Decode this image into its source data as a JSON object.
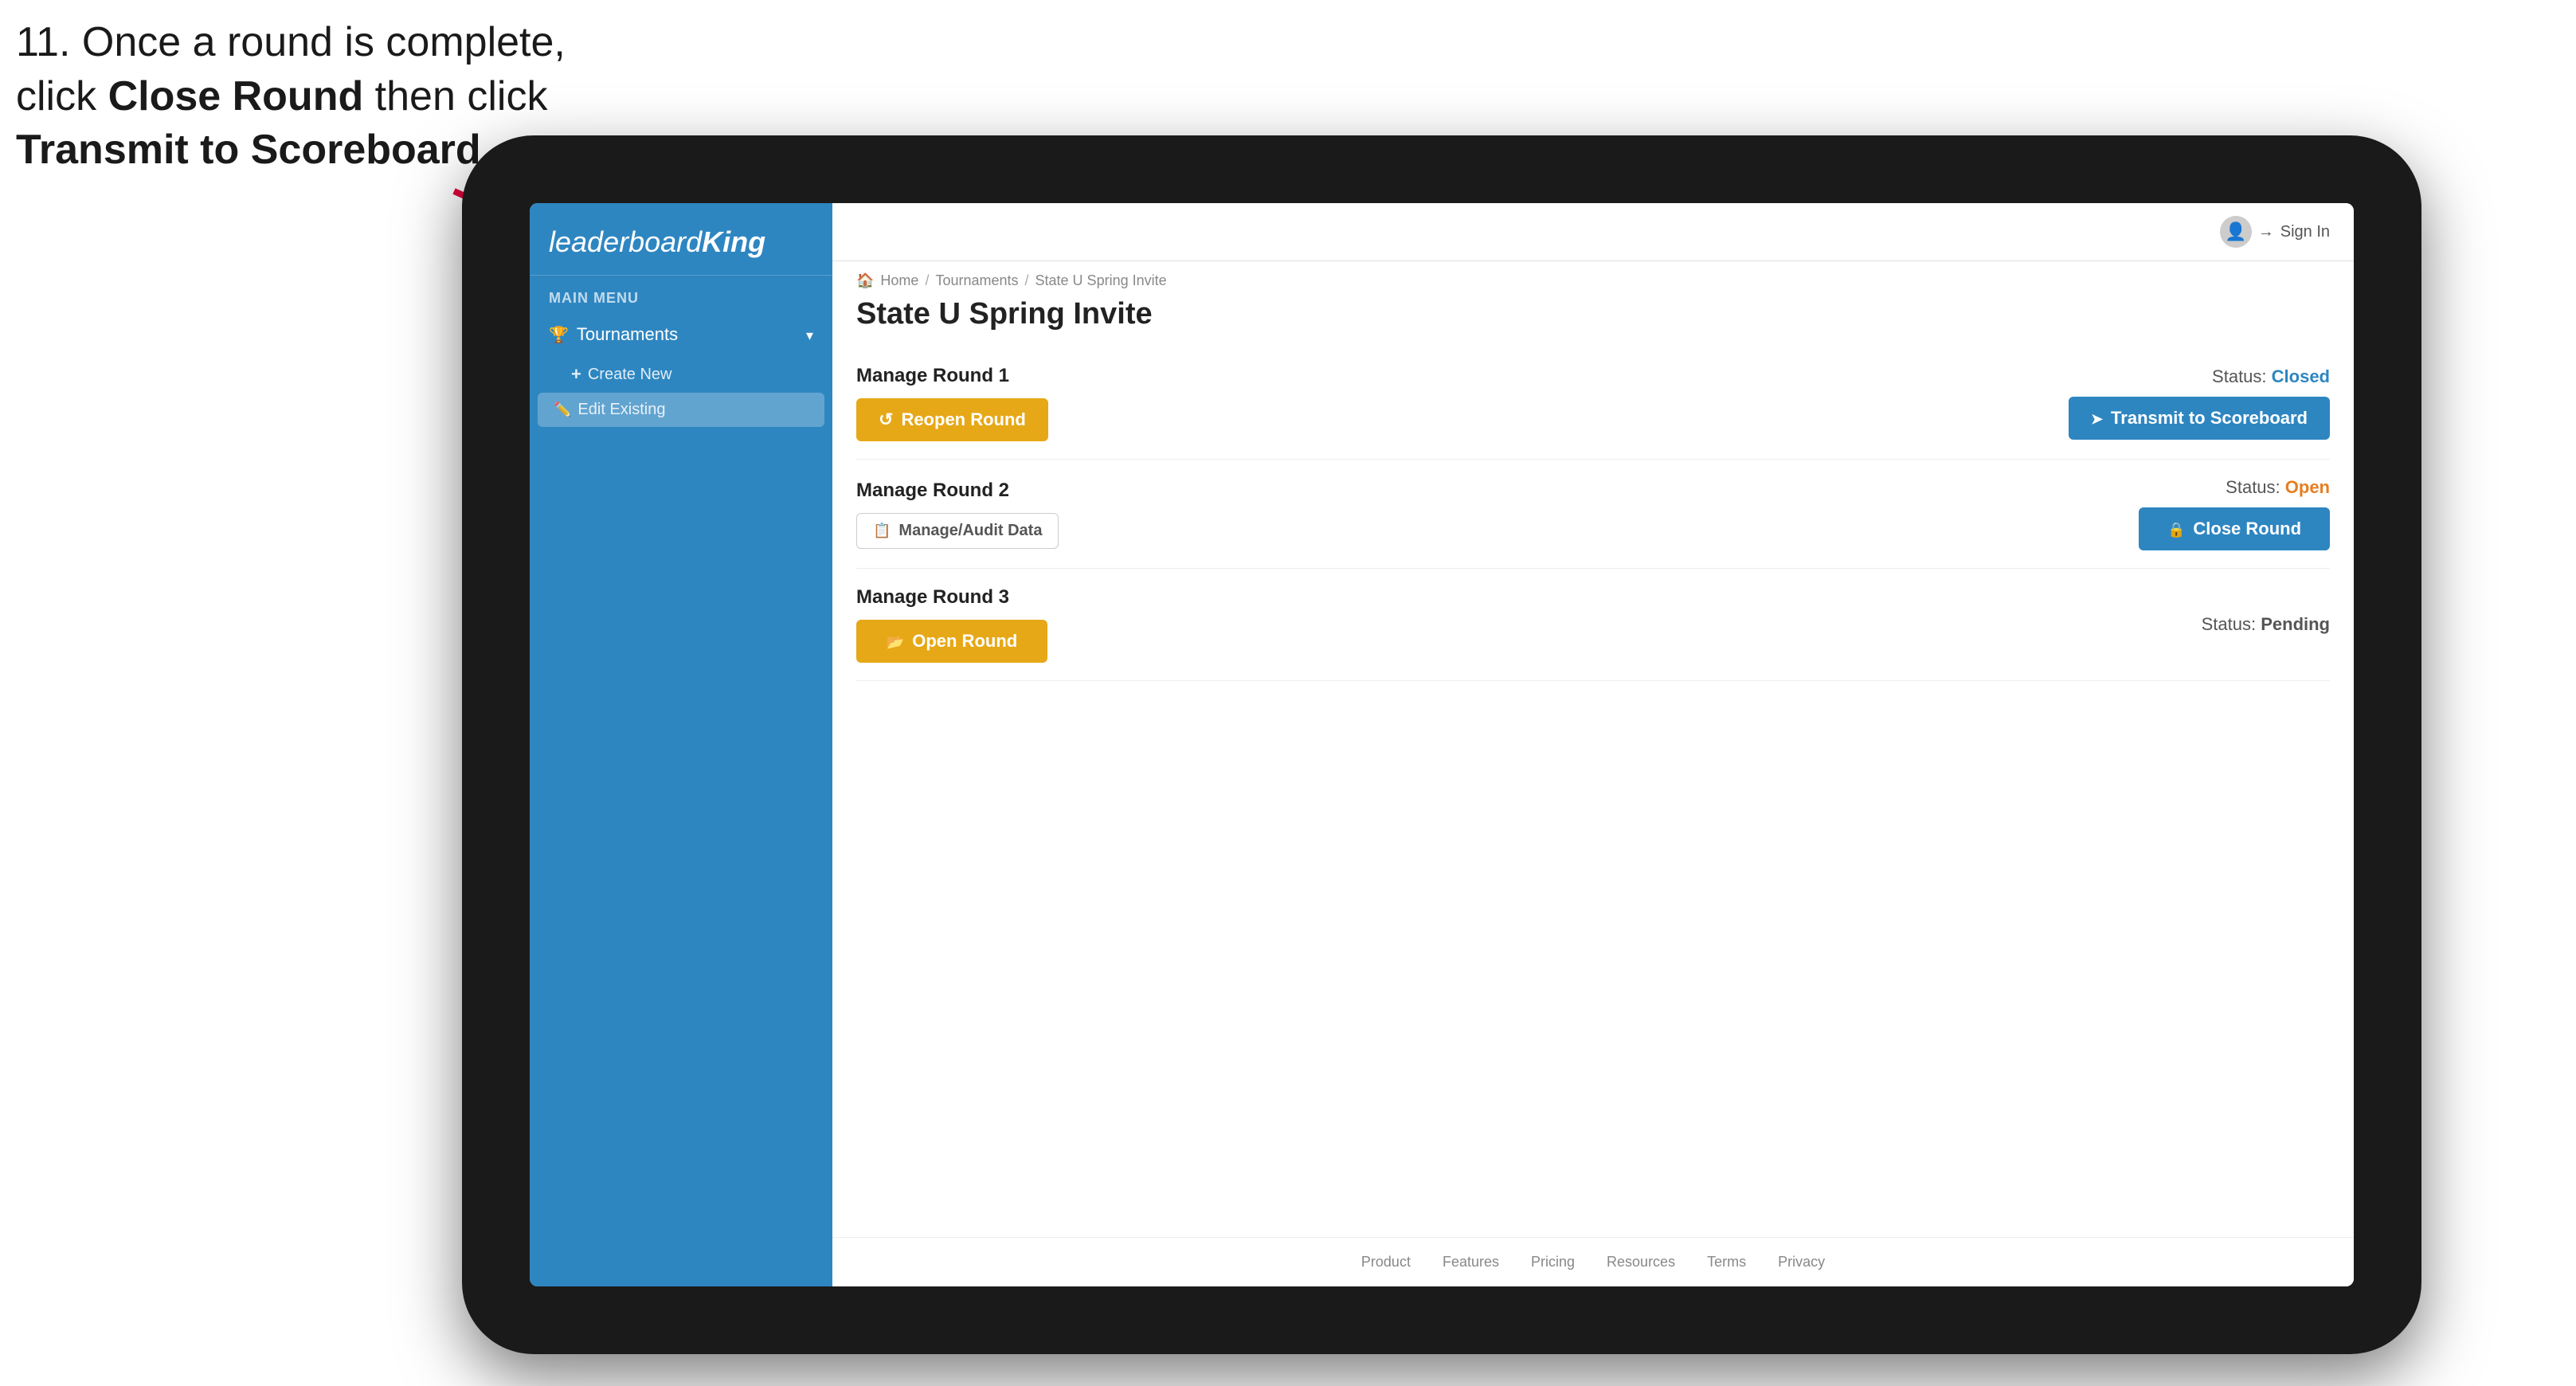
{
  "instruction": {
    "line1": "11. Once a round is complete,",
    "line2_prefix": "click ",
    "line2_bold": "Close Round",
    "line2_suffix": " then click",
    "line3_bold": "Transmit to Scoreboard."
  },
  "app": {
    "logo": {
      "text_regular": "leaderboard",
      "text_bold": "King"
    },
    "sidebar": {
      "menu_label": "MAIN MENU",
      "tournaments_label": "Tournaments",
      "create_new_label": "Create New",
      "edit_existing_label": "Edit Existing"
    },
    "topnav": {
      "sign_in_label": "Sign In"
    },
    "breadcrumb": {
      "home": "Home",
      "tournaments": "Tournaments",
      "current": "State U Spring Invite"
    },
    "page_title": "State U Spring Invite",
    "rounds": [
      {
        "id": "round1",
        "title": "Manage Round 1",
        "status_label": "Status:",
        "status_value": "Closed",
        "status_type": "closed",
        "primary_btn_label": "Reopen Round",
        "primary_btn_type": "orange",
        "secondary_btn_label": "Transmit to Scoreboard",
        "secondary_btn_type": "blue"
      },
      {
        "id": "round2",
        "title": "Manage Round 2",
        "status_label": "Status:",
        "status_value": "Open",
        "status_type": "open",
        "primary_btn_label": "Manage/Audit Data",
        "primary_btn_type": "outline",
        "secondary_btn_label": "Close Round",
        "secondary_btn_type": "blue"
      },
      {
        "id": "round3",
        "title": "Manage Round 3",
        "status_label": "Status:",
        "status_value": "Pending",
        "status_type": "pending",
        "primary_btn_label": "Open Round",
        "primary_btn_type": "orange"
      }
    ],
    "footer": {
      "links": [
        "Product",
        "Features",
        "Pricing",
        "Resources",
        "Terms",
        "Privacy"
      ]
    }
  }
}
